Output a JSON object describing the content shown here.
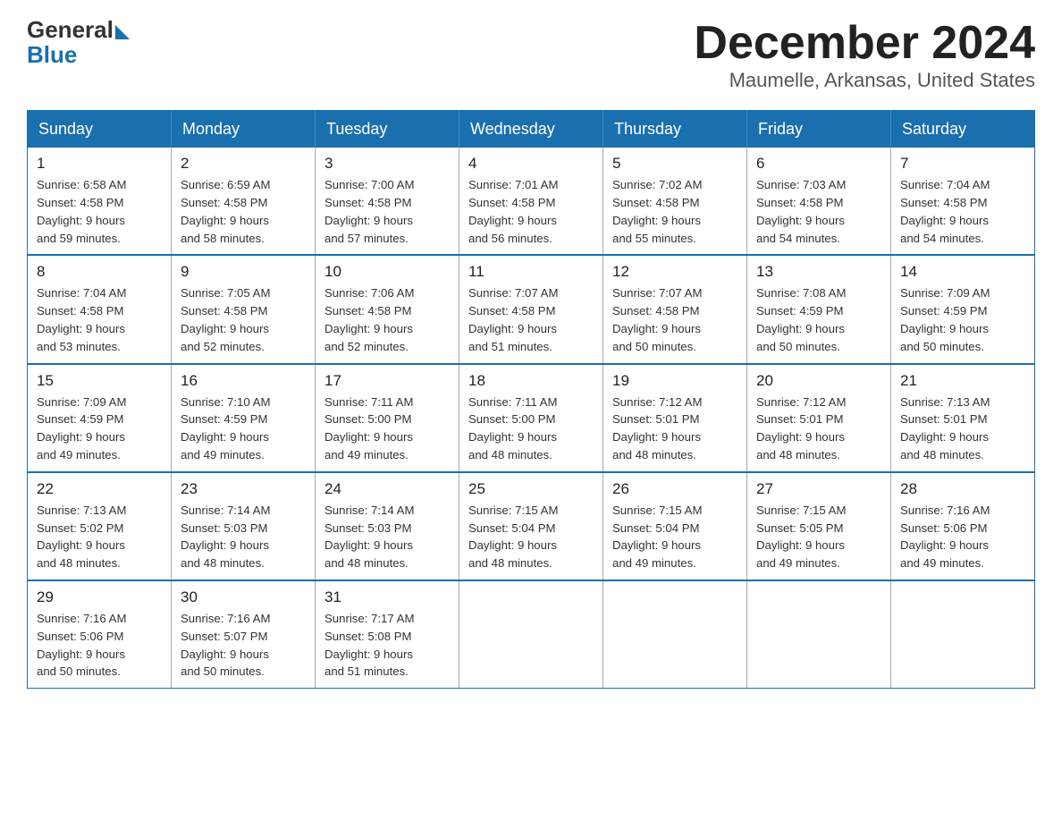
{
  "logo": {
    "general": "General",
    "blue": "Blue"
  },
  "title": "December 2024",
  "subtitle": "Maumelle, Arkansas, United States",
  "days_of_week": [
    "Sunday",
    "Monday",
    "Tuesday",
    "Wednesday",
    "Thursday",
    "Friday",
    "Saturday"
  ],
  "weeks": [
    [
      {
        "day": "1",
        "sunrise": "6:58 AM",
        "sunset": "4:58 PM",
        "daylight": "9 hours and 59 minutes."
      },
      {
        "day": "2",
        "sunrise": "6:59 AM",
        "sunset": "4:58 PM",
        "daylight": "9 hours and 58 minutes."
      },
      {
        "day": "3",
        "sunrise": "7:00 AM",
        "sunset": "4:58 PM",
        "daylight": "9 hours and 57 minutes."
      },
      {
        "day": "4",
        "sunrise": "7:01 AM",
        "sunset": "4:58 PM",
        "daylight": "9 hours and 56 minutes."
      },
      {
        "day": "5",
        "sunrise": "7:02 AM",
        "sunset": "4:58 PM",
        "daylight": "9 hours and 55 minutes."
      },
      {
        "day": "6",
        "sunrise": "7:03 AM",
        "sunset": "4:58 PM",
        "daylight": "9 hours and 54 minutes."
      },
      {
        "day": "7",
        "sunrise": "7:04 AM",
        "sunset": "4:58 PM",
        "daylight": "9 hours and 54 minutes."
      }
    ],
    [
      {
        "day": "8",
        "sunrise": "7:04 AM",
        "sunset": "4:58 PM",
        "daylight": "9 hours and 53 minutes."
      },
      {
        "day": "9",
        "sunrise": "7:05 AM",
        "sunset": "4:58 PM",
        "daylight": "9 hours and 52 minutes."
      },
      {
        "day": "10",
        "sunrise": "7:06 AM",
        "sunset": "4:58 PM",
        "daylight": "9 hours and 52 minutes."
      },
      {
        "day": "11",
        "sunrise": "7:07 AM",
        "sunset": "4:58 PM",
        "daylight": "9 hours and 51 minutes."
      },
      {
        "day": "12",
        "sunrise": "7:07 AM",
        "sunset": "4:58 PM",
        "daylight": "9 hours and 50 minutes."
      },
      {
        "day": "13",
        "sunrise": "7:08 AM",
        "sunset": "4:59 PM",
        "daylight": "9 hours and 50 minutes."
      },
      {
        "day": "14",
        "sunrise": "7:09 AM",
        "sunset": "4:59 PM",
        "daylight": "9 hours and 50 minutes."
      }
    ],
    [
      {
        "day": "15",
        "sunrise": "7:09 AM",
        "sunset": "4:59 PM",
        "daylight": "9 hours and 49 minutes."
      },
      {
        "day": "16",
        "sunrise": "7:10 AM",
        "sunset": "4:59 PM",
        "daylight": "9 hours and 49 minutes."
      },
      {
        "day": "17",
        "sunrise": "7:11 AM",
        "sunset": "5:00 PM",
        "daylight": "9 hours and 49 minutes."
      },
      {
        "day": "18",
        "sunrise": "7:11 AM",
        "sunset": "5:00 PM",
        "daylight": "9 hours and 48 minutes."
      },
      {
        "day": "19",
        "sunrise": "7:12 AM",
        "sunset": "5:01 PM",
        "daylight": "9 hours and 48 minutes."
      },
      {
        "day": "20",
        "sunrise": "7:12 AM",
        "sunset": "5:01 PM",
        "daylight": "9 hours and 48 minutes."
      },
      {
        "day": "21",
        "sunrise": "7:13 AM",
        "sunset": "5:01 PM",
        "daylight": "9 hours and 48 minutes."
      }
    ],
    [
      {
        "day": "22",
        "sunrise": "7:13 AM",
        "sunset": "5:02 PM",
        "daylight": "9 hours and 48 minutes."
      },
      {
        "day": "23",
        "sunrise": "7:14 AM",
        "sunset": "5:03 PM",
        "daylight": "9 hours and 48 minutes."
      },
      {
        "day": "24",
        "sunrise": "7:14 AM",
        "sunset": "5:03 PM",
        "daylight": "9 hours and 48 minutes."
      },
      {
        "day": "25",
        "sunrise": "7:15 AM",
        "sunset": "5:04 PM",
        "daylight": "9 hours and 48 minutes."
      },
      {
        "day": "26",
        "sunrise": "7:15 AM",
        "sunset": "5:04 PM",
        "daylight": "9 hours and 49 minutes."
      },
      {
        "day": "27",
        "sunrise": "7:15 AM",
        "sunset": "5:05 PM",
        "daylight": "9 hours and 49 minutes."
      },
      {
        "day": "28",
        "sunrise": "7:16 AM",
        "sunset": "5:06 PM",
        "daylight": "9 hours and 49 minutes."
      }
    ],
    [
      {
        "day": "29",
        "sunrise": "7:16 AM",
        "sunset": "5:06 PM",
        "daylight": "9 hours and 50 minutes."
      },
      {
        "day": "30",
        "sunrise": "7:16 AM",
        "sunset": "5:07 PM",
        "daylight": "9 hours and 50 minutes."
      },
      {
        "day": "31",
        "sunrise": "7:17 AM",
        "sunset": "5:08 PM",
        "daylight": "9 hours and 51 minutes."
      },
      null,
      null,
      null,
      null
    ]
  ],
  "labels": {
    "sunrise": "Sunrise:",
    "sunset": "Sunset:",
    "daylight": "Daylight:"
  }
}
